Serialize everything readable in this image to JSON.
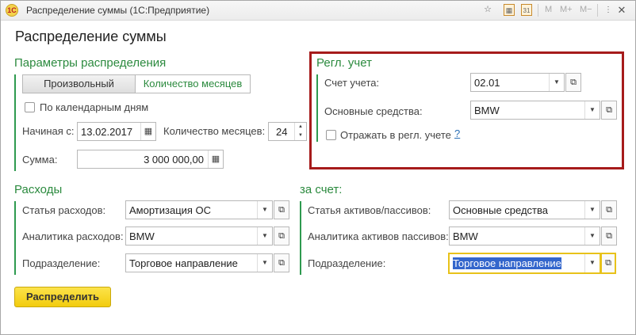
{
  "window": {
    "title": "Распределение суммы  (1С:Предприятие)",
    "app_icon_glyph": "1С",
    "toolbar_buttons": [
      "M",
      "M+",
      "M−"
    ],
    "close_glyph": "✕"
  },
  "form": {
    "title": "Распределение суммы"
  },
  "params": {
    "header": "Параметры распределения",
    "mode_options": [
      "Произвольный",
      "Количество месяцев"
    ],
    "calendar_days_label": "По календарным дням",
    "start_label": "Начиная с:",
    "start_value": "13.02.2017",
    "months_label": "Количество месяцев:",
    "months_value": "24",
    "sum_label": "Сумма:",
    "sum_value": "3 000 000,00"
  },
  "regl": {
    "header": "Регл. учет",
    "account_label": "Счет учета:",
    "account_value": "02.01",
    "asset_label": "Основные средства:",
    "asset_value": "BMW",
    "reflect_label": "Отражать в регл. учете",
    "help_glyph": "?"
  },
  "expenses": {
    "header": "Расходы",
    "item_label": "Статья расходов:",
    "item_value": "Амортизация ОС",
    "analytics_label": "Аналитика расходов:",
    "analytics_value": "BMW",
    "division_label": "Подразделение:",
    "division_value": "Торговое направление"
  },
  "credit": {
    "header": "за счет:",
    "item_label": "Статья активов/пассивов:",
    "item_value": "Основные средства",
    "analytics_label": "Аналитика активов пассивов:",
    "analytics_value": "BMW",
    "division_label": "Подразделение:",
    "division_value": "Торговое направление"
  },
  "actions": {
    "distribute_label": "Распределить"
  },
  "colors": {
    "accent_green": "#2e9a4f",
    "highlight_red": "#a61b1b",
    "button_yellow": "#f2cc0e",
    "focus_yellow": "#e8c21a"
  }
}
